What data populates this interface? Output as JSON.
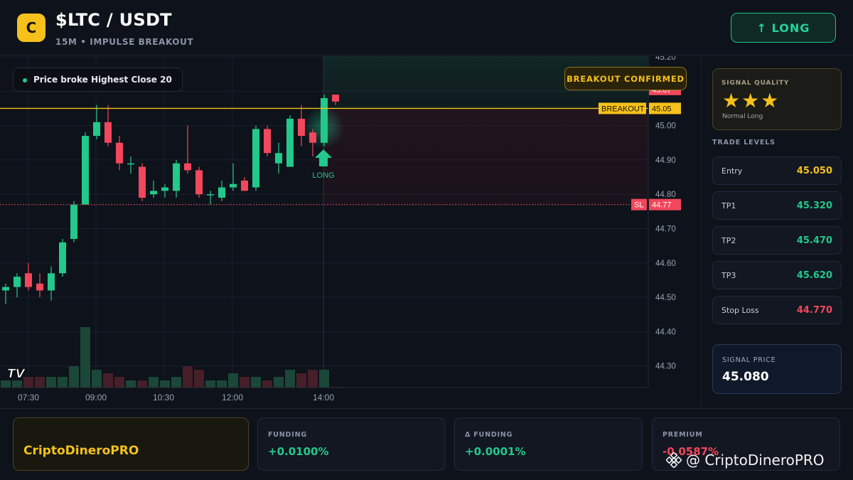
{
  "header": {
    "logo_letter": "C",
    "title": "$LTC / USDT",
    "subtitle": "15M • IMPULSE BREAKOUT",
    "long_button": "↑ LONG"
  },
  "chart": {
    "info_pill": "Price broke Highest Close 20",
    "breakout_badge": "BREAKOUT CONFIRMED",
    "long_marker": "LONG",
    "tv_logo": "TV",
    "price_labels": {
      "current": "45.07",
      "breakout_tag": "BREAKOUT",
      "breakout": "45.05",
      "sl_tag": "SL",
      "sl": "44.77"
    },
    "colors": {
      "up": "#22c98a",
      "down": "#f2475c",
      "breakout_line": "#f5c11a",
      "sl_line": "#e0495a"
    }
  },
  "chart_data": {
    "type": "candlestick",
    "timeframe": "15M",
    "x_ticks": [
      "07:30",
      "09:00",
      "10:30",
      "12:00",
      "14:00"
    ],
    "y_ticks": [
      "45.20",
      "45.10",
      "45.00",
      "44.90",
      "44.80",
      "44.70",
      "44.60",
      "44.50",
      "44.40",
      "44.30"
    ],
    "ylim": [
      44.24,
      45.21
    ],
    "breakout_level": 45.05,
    "stop_loss": 44.77,
    "current_price": 45.07,
    "candles": [
      {
        "o": 44.52,
        "h": 44.54,
        "l": 44.48,
        "c": 44.53
      },
      {
        "o": 44.53,
        "h": 44.57,
        "l": 44.5,
        "c": 44.56
      },
      {
        "o": 44.57,
        "h": 44.6,
        "l": 44.52,
        "c": 44.53
      },
      {
        "o": 44.54,
        "h": 44.57,
        "l": 44.5,
        "c": 44.52
      },
      {
        "o": 44.52,
        "h": 44.59,
        "l": 44.49,
        "c": 44.57
      },
      {
        "o": 44.57,
        "h": 44.67,
        "l": 44.56,
        "c": 44.66
      },
      {
        "o": 44.67,
        "h": 44.78,
        "l": 44.66,
        "c": 44.77
      },
      {
        "o": 44.77,
        "h": 44.98,
        "l": 44.77,
        "c": 44.97
      },
      {
        "o": 44.97,
        "h": 45.06,
        "l": 44.96,
        "c": 45.01
      },
      {
        "o": 45.01,
        "h": 45.06,
        "l": 44.94,
        "c": 44.95
      },
      {
        "o": 44.95,
        "h": 44.97,
        "l": 44.87,
        "c": 44.89
      },
      {
        "o": 44.89,
        "h": 44.91,
        "l": 44.86,
        "c": 44.89
      },
      {
        "o": 44.88,
        "h": 44.89,
        "l": 44.78,
        "c": 44.79
      },
      {
        "o": 44.8,
        "h": 44.84,
        "l": 44.79,
        "c": 44.81
      },
      {
        "o": 44.81,
        "h": 44.83,
        "l": 44.79,
        "c": 44.82
      },
      {
        "o": 44.81,
        "h": 44.9,
        "l": 44.79,
        "c": 44.89
      },
      {
        "o": 44.89,
        "h": 45.0,
        "l": 44.86,
        "c": 44.87
      },
      {
        "o": 44.87,
        "h": 44.88,
        "l": 44.79,
        "c": 44.8
      },
      {
        "o": 44.8,
        "h": 44.81,
        "l": 44.77,
        "c": 44.8
      },
      {
        "o": 44.79,
        "h": 44.84,
        "l": 44.78,
        "c": 44.82
      },
      {
        "o": 44.82,
        "h": 44.89,
        "l": 44.81,
        "c": 44.83
      },
      {
        "o": 44.84,
        "h": 44.85,
        "l": 44.81,
        "c": 44.81
      },
      {
        "o": 44.82,
        "h": 45.0,
        "l": 44.81,
        "c": 44.99
      },
      {
        "o": 44.99,
        "h": 45.0,
        "l": 44.91,
        "c": 44.92
      },
      {
        "o": 44.89,
        "h": 44.95,
        "l": 44.86,
        "c": 44.92
      },
      {
        "o": 44.88,
        "h": 45.03,
        "l": 44.88,
        "c": 45.02
      },
      {
        "o": 45.02,
        "h": 45.06,
        "l": 44.94,
        "c": 44.97
      },
      {
        "o": 44.98,
        "h": 44.99,
        "l": 44.91,
        "c": 44.95
      },
      {
        "o": 44.95,
        "h": 45.09,
        "l": 44.94,
        "c": 45.08
      },
      {
        "o": 45.09,
        "h": 45.09,
        "l": 45.06,
        "c": 45.07
      }
    ],
    "volume": [
      2,
      2,
      3,
      3,
      3,
      3,
      6,
      17,
      5,
      4,
      3,
      2,
      2,
      3,
      2,
      3,
      6,
      5,
      2,
      2,
      4,
      3,
      3,
      2,
      3,
      5,
      4,
      5,
      5,
      0
    ]
  },
  "side": {
    "quality_label": "SIGNAL QUALITY",
    "stars": "★★★",
    "quality_sub": "Normal Long",
    "levels_title": "TRADE LEVELS",
    "levels": [
      {
        "name": "Entry",
        "value": "45.050",
        "color": "#f5c11a"
      },
      {
        "name": "TP1",
        "value": "45.320",
        "color": "#22c98a"
      },
      {
        "name": "TP2",
        "value": "45.470",
        "color": "#22c98a"
      },
      {
        "name": "TP3",
        "value": "45.620",
        "color": "#22c98a"
      },
      {
        "name": "Stop Loss",
        "value": "44.770",
        "color": "#f2475c"
      }
    ],
    "signal_price_label": "SIGNAL PRICE",
    "signal_price": "45.080"
  },
  "footer": {
    "brand": "CriptoDineroPRO",
    "stats": [
      {
        "label": "FUNDING",
        "value": "+0.0100%",
        "color": "#22c98a"
      },
      {
        "label": "Δ FUNDING",
        "value": "+0.0001%",
        "color": "#22c98a"
      },
      {
        "label": "PREMIUM",
        "value": "-0.0587%",
        "color": "#f2475c"
      }
    ],
    "watermark": "@ CriptoDineroPRO"
  }
}
